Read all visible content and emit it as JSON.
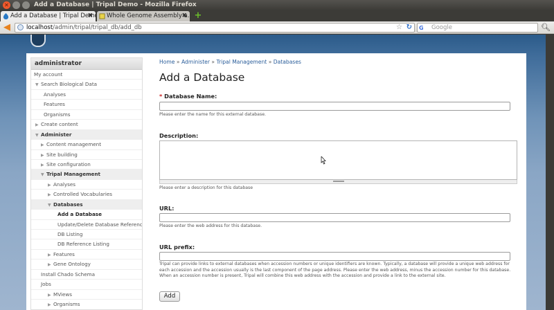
{
  "window": {
    "title": "Add a Database | Tripal Demo - Mozilla Firefox"
  },
  "tabs": [
    {
      "label": "Add a Database | Tripal Demo",
      "active": true
    },
    {
      "label": "Whole Genome Assembly a...",
      "active": false
    }
  ],
  "navbar": {
    "url_host": "localhost",
    "url_path": "/admin/tripal/tripal_db/add_db",
    "search_placeholder": "Google",
    "search_engine": "G"
  },
  "sidebar": {
    "title": "administrator",
    "items": [
      {
        "label": "My account",
        "indent": 0,
        "arrow": "",
        "style": ""
      },
      {
        "label": "Search Biological Data",
        "indent": 1,
        "arrow": "▼",
        "style": ""
      },
      {
        "label": "Analyses",
        "indent": 2,
        "arrow": "",
        "style": ""
      },
      {
        "label": "Features",
        "indent": 2,
        "arrow": "",
        "style": ""
      },
      {
        "label": "Organisms",
        "indent": 2,
        "arrow": "",
        "style": ""
      },
      {
        "label": "Create content",
        "indent": 1,
        "arrow": "▶",
        "style": ""
      },
      {
        "label": "Administer",
        "indent": 1,
        "arrow": "▼",
        "style": "section"
      },
      {
        "label": "Content management",
        "indent": 3,
        "arrow": "▶",
        "style": ""
      },
      {
        "label": "Site building",
        "indent": 3,
        "arrow": "▶",
        "style": ""
      },
      {
        "label": "Site configuration",
        "indent": 3,
        "arrow": "▶",
        "style": ""
      },
      {
        "label": "Tripal Management",
        "indent": 3,
        "arrow": "▼",
        "style": "section"
      },
      {
        "label": "Analyses",
        "indent": 4,
        "arrow": "▶",
        "style": ""
      },
      {
        "label": "Controlled Vocabularies",
        "indent": 4,
        "arrow": "▶",
        "style": ""
      },
      {
        "label": "Databases",
        "indent": 4,
        "arrow": "▼",
        "style": "section"
      },
      {
        "label": "Add a Database",
        "indent": 5,
        "arrow": "",
        "style": "active"
      },
      {
        "label": "Update/Delete Database References",
        "indent": 5,
        "arrow": "",
        "style": ""
      },
      {
        "label": "DB Listing",
        "indent": 5,
        "arrow": "",
        "style": ""
      },
      {
        "label": "DB Reference Listing",
        "indent": 5,
        "arrow": "",
        "style": ""
      },
      {
        "label": "Features",
        "indent": 4,
        "arrow": "▶",
        "style": ""
      },
      {
        "label": "Gene Ontology",
        "indent": 4,
        "arrow": "▶",
        "style": ""
      },
      {
        "label": "Install Chado Schema",
        "indent": 3,
        "arrow": "",
        "style": ""
      },
      {
        "label": "Jobs",
        "indent": 3,
        "arrow": "",
        "style": ""
      },
      {
        "label": "MViews",
        "indent": 4,
        "arrow": "▶",
        "style": ""
      },
      {
        "label": "Organisms",
        "indent": 4,
        "arrow": "▶",
        "style": ""
      }
    ]
  },
  "breadcrumb": [
    "Home",
    "Administer",
    "Tripal Management",
    "Databases"
  ],
  "breadcrumb_sep": "»",
  "page_title": "Add a Database",
  "form": {
    "required_marker": "*",
    "name_label": "Database Name:",
    "name_help": "Please enter the name for this external database.",
    "description_label": "Description:",
    "description_help": "Please enter a description for this database",
    "url_label": "URL:",
    "url_help": "Please enter the web address for this database.",
    "url_prefix_label": "URL prefix:",
    "url_prefix_help": "Tripal can provide links to external databases when accession numbers or unique identifiers are known. Typically, a database will provide a unique web address for each accession and the accession usually is the last component of the page address. Please enter the web address, minus the accession number for this database. When an accession number is present, Tripal will combine this web address with the accession and provide a link to the external site.",
    "submit_label": "Add"
  },
  "colors": {
    "link": "#2a5d9a",
    "required": "#cc2222",
    "page_header": "#2b5b8a"
  }
}
